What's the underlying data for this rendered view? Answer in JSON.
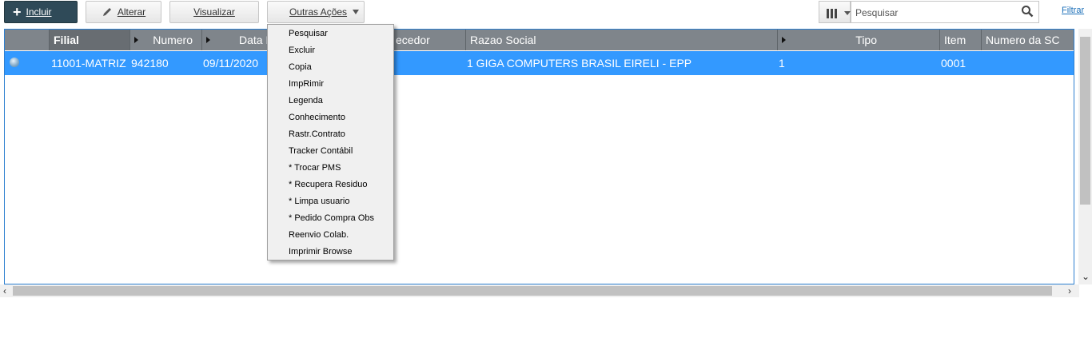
{
  "toolbar": {
    "incluir": "Incluir",
    "alterar": "Alterar",
    "visualizar": "Visualizar",
    "outras_acoes": "Outras Ações",
    "search_placeholder": "Pesquisar",
    "filtro": "Filtrar"
  },
  "grid": {
    "columns": [
      "Filial",
      "Numero",
      "Data",
      "Fornecedor",
      "Razao Social",
      "Tipo",
      "Item",
      "Numero da SC"
    ],
    "visible_headers": {
      "filial": "Filial",
      "numero": "Numero",
      "data": "Data E",
      "fornecedor": "ecedor",
      "razao": "Razao Social",
      "tipo": "Tipo",
      "item": "Item",
      "numero_sc": "Numero da SC"
    },
    "rows": [
      {
        "filial": "11001-MATRIZ",
        "numero": "942180",
        "data": "09/11/2020",
        "razao": "1 GIGA COMPUTERS BRASIL EIRELI - EPP",
        "tipo": "1",
        "item": "0001",
        "numero_sc": ""
      }
    ]
  },
  "menu": {
    "items": [
      "Pesquisar",
      "Excluir",
      "Copia",
      "ImpRimir",
      "Legenda",
      "Conhecimento",
      "Rastr.Contrato",
      "Tracker Contábil",
      "* Trocar PMS",
      "* Recupera Residuo",
      "* Limpa usuario",
      "* Pedido Compra Obs",
      "Reenvio Colab.",
      "Imprimir Browse"
    ]
  },
  "colors": {
    "selected_row": "#3399ff",
    "header_bg": "#7f858b",
    "primary_button": "#2f4a58"
  }
}
